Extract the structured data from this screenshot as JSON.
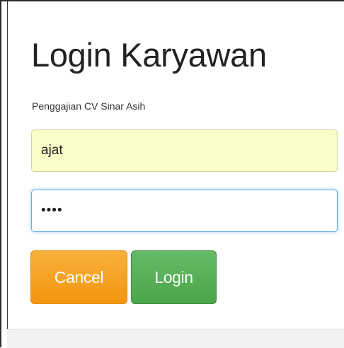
{
  "login": {
    "title": "Login Karyawan",
    "subtitle": "Penggajian CV Sinar Asih",
    "username_value": "ajat",
    "password_value": "••••",
    "cancel_label": "Cancel",
    "login_label": "Login"
  },
  "colors": {
    "cancel_button": "#f3950f",
    "login_button": "#4aa54a",
    "username_background": "#fbfdc8",
    "password_focus_border": "#66afe9"
  }
}
